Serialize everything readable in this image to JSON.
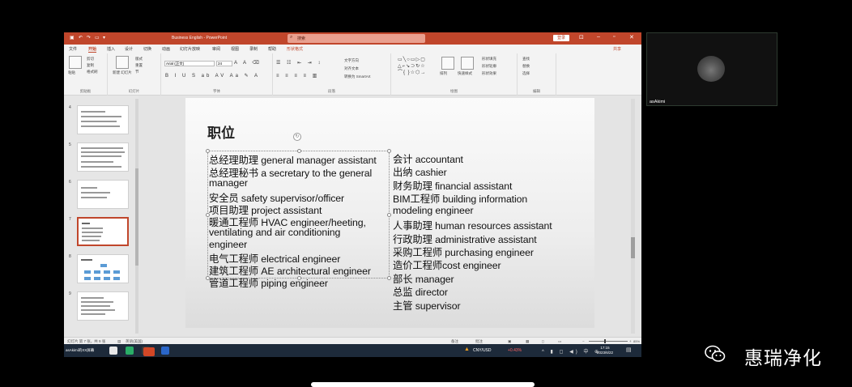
{
  "titlebar": {
    "doc_title": "Business English - PowerPoint",
    "search_placeholder": "搜索",
    "login": "登录",
    "icons": [
      "save-icon",
      "undo-icon",
      "redo-icon",
      "present-icon"
    ]
  },
  "menu": {
    "items": [
      "文件",
      "开始",
      "插入",
      "设计",
      "切换",
      "动画",
      "幻灯片放映",
      "审阅",
      "视图",
      "录制",
      "帮助",
      "形状格式"
    ],
    "active_index": 1,
    "share": "共享"
  },
  "ribbon": {
    "groups": [
      "剪贴板",
      "幻灯片",
      "字体",
      "段落",
      "绘图",
      "编辑"
    ],
    "paste": "粘贴",
    "new_slide": "新建\n幻灯片",
    "font_name": "Arial (正文)",
    "font_size": "24",
    "clipboard_small": [
      "剪切",
      "复制",
      "格式刷"
    ],
    "slide_small": [
      "版式",
      "重置",
      "节"
    ],
    "para_small": [
      "文字方向",
      "对齐文本",
      "转换为 SmartArt"
    ],
    "draw_small": [
      "排列",
      "快速样式",
      "形状填充",
      "形状轮廓",
      "形状效果"
    ],
    "edit_small": [
      "查找",
      "替换",
      "选择"
    ]
  },
  "slide_panel": {
    "numbers": [
      "4",
      "5",
      "6",
      "7",
      "8",
      "9"
    ],
    "active_index": 3
  },
  "slide": {
    "title": "职位",
    "left_lines": [
      "总经理助理 general manager assistant",
      "总经理秘书 a secretary to the general",
      "manager",
      "安全员 safety supervisor/officer",
      "项目助理 project assistant",
      "暖通工程师  HVAC engineer/heeting,",
      "ventilating and air conditioning",
      "engineer",
      "电气工程师  electrical engineer",
      "建筑工程师  AE architectural engineer",
      "管道工程师  piping engineer"
    ],
    "right_lines": [
      "会计  accountant",
      "出纳  cashier",
      "财务助理  financial assistant",
      "BIM工程师  building information",
      "modeling engineer",
      "人事助理  human resources assistant",
      "行政助理  administrative assistant",
      "采购工程师 purchasing engineer",
      "造价工程师cost engineer",
      "部长 manager",
      "总监 director",
      "主管 supervisor"
    ]
  },
  "statusbar": {
    "slide_count": "幻灯片 第 7 张，共 9 张",
    "language": "英语(美国)",
    "notes": "备注",
    "comments": "批注",
    "zoom": "85%"
  },
  "taskbar": {
    "start_label": "asAkimi的XX屏幕",
    "currency": "CNY/USD",
    "currency_change": "+0.43%",
    "time": "17:15",
    "date": "2023/6/22"
  },
  "webcam": {
    "name": "asAkimi"
  },
  "watermark": {
    "text": "惠瑞净化"
  },
  "colors": {
    "accent": "#c0462b",
    "taskbar": "#1d2a3a",
    "currency_change": "#ff6161"
  }
}
